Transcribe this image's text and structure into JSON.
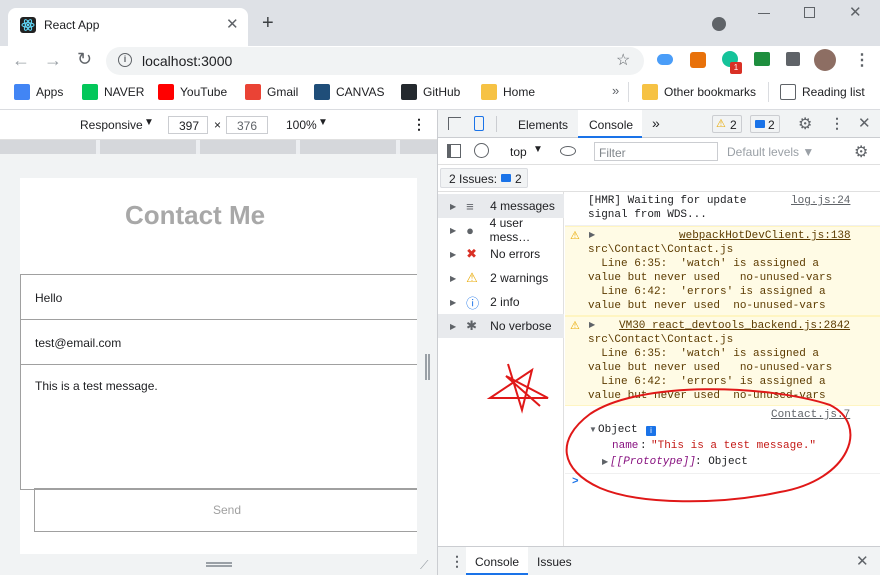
{
  "browser": {
    "tab_title": "React App",
    "url": "localhost:3000"
  },
  "bookmarks": [
    {
      "label": "Apps",
      "icon": "apps-grid-icon",
      "color": "#4285f4"
    },
    {
      "label": "NAVER",
      "icon": "naver-icon",
      "color": "#03c75a"
    },
    {
      "label": "YouTube",
      "icon": "youtube-icon",
      "color": "#ff0000"
    },
    {
      "label": "Gmail",
      "icon": "gmail-icon",
      "color": "#ea4335"
    },
    {
      "label": "CANVAS",
      "icon": "canvas-icon",
      "color": "#1f4e79"
    },
    {
      "label": "GitHub",
      "icon": "github-icon",
      "color": "#24292e"
    },
    {
      "label": "Home",
      "icon": "folder-icon",
      "color": "#f6c244"
    }
  ],
  "bookmarks_right": {
    "other": "Other bookmarks",
    "reading": "Reading list"
  },
  "device_bar": {
    "mode": "Responsive",
    "width": "397",
    "sep": "×",
    "height": "376",
    "zoom": "100%"
  },
  "page": {
    "heading": "Contact Me",
    "name_value": "Hello",
    "email_value": "test@email.com",
    "message_value": "This is a test message.",
    "send_label": "Send"
  },
  "devtools": {
    "tabs": {
      "elements": "Elements",
      "console": "Console",
      "more": "»"
    },
    "warn_count": "2",
    "info_count": "2",
    "filter_placeholder": "Filter",
    "context": "top",
    "levels": "Default levels ▼",
    "issues_label": "2 Issues:",
    "issues_count": "2",
    "sidebar": [
      {
        "label": "4 messages",
        "icon": "list-icon"
      },
      {
        "label": "4 user mess…",
        "icon": "user-icon"
      },
      {
        "label": "No errors",
        "icon": "error-icon"
      },
      {
        "label": "2 warnings",
        "icon": "warning-icon"
      },
      {
        "label": "2 info",
        "icon": "info-icon"
      },
      {
        "label": "No verbose",
        "icon": "bug-icon"
      }
    ],
    "log1": {
      "lines": [
        "[HMR] Waiting for update",
        "signal from WDS..."
      ],
      "source": "log.js:24"
    },
    "warn1": {
      "source": "webpackHotDevClient.js:138",
      "lines": [
        "src\\Contact\\Contact.js",
        "  Line 6:35:  'watch' is assigned a",
        "value but never used   no-unused-vars",
        "  Line 6:42:  'errors' is assigned a",
        "value but never used  no-unused-vars"
      ]
    },
    "warn2": {
      "source": "VM30 react_devtools_backend.js:2842",
      "lines": [
        "src\\Contact\\Contact.js",
        "  Line 6:35:  'watch' is assigned a",
        "value but never used   no-unused-vars",
        "  Line 6:42:  'errors' is assigned a",
        "value but never used  no-unused-vars"
      ]
    },
    "obj": {
      "source": "Contact.js:7",
      "label": "Object",
      "key": "name",
      "value": "\"This is a test message.\"",
      "proto": "[[Prototype]]",
      "proto_value": ": Object"
    },
    "prompt": ">",
    "drawer_tabs": {
      "console": "Console",
      "issues": "Issues"
    }
  }
}
